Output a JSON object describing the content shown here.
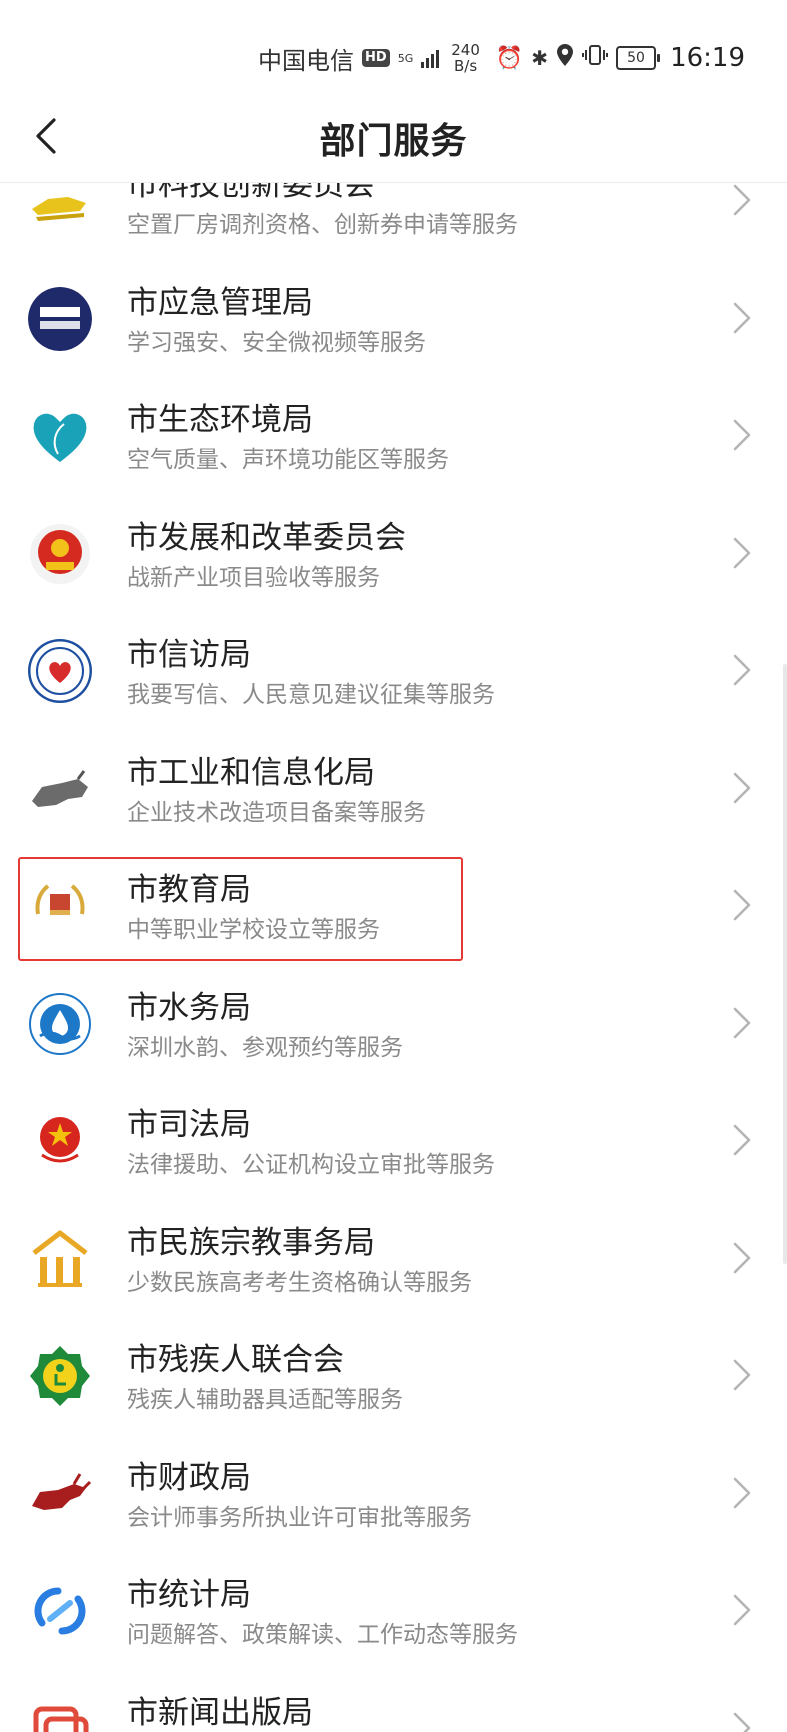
{
  "status_bar": {
    "carrier": "中国电信",
    "hd": "HD",
    "network": "5G",
    "speed_value": "240",
    "speed_unit": "B/s",
    "battery": "50",
    "time": "16:19",
    "icons": [
      "alarm-icon",
      "bluetooth-icon",
      "location-icon",
      "vibrate-icon",
      "battery-icon"
    ]
  },
  "header": {
    "title": "部门服务",
    "back_icon": "chevron-left-icon"
  },
  "highlight_color": "#e53935",
  "departments": [
    {
      "name": "市科技创新委员会",
      "desc": "空置厂房调剂资格、创新券申请等服务",
      "logo": "gold-lion-logo"
    },
    {
      "name": "市应急管理局",
      "desc": "学习强安、安全微视频等服务",
      "logo": "emergency-logo"
    },
    {
      "name": "市生态环境局",
      "desc": "空气质量、声环境功能区等服务",
      "logo": "heart-leaf-logo"
    },
    {
      "name": "市发展和改革委员会",
      "desc": "战新产业项目验收等服务",
      "logo": "national-emblem-logo"
    },
    {
      "name": "市信访局",
      "desc": "我要写信、人民意见建议征集等服务",
      "logo": "petition-logo"
    },
    {
      "name": "市工业和信息化局",
      "desc": "企业技术改造项目备案等服务",
      "logo": "bull-logo"
    },
    {
      "name": "市教育局",
      "desc": "中等职业学校设立等服务",
      "logo": "education-logo"
    },
    {
      "name": "市水务局",
      "desc": "深圳水韵、参观预约等服务",
      "logo": "water-logo"
    },
    {
      "name": "市司法局",
      "desc": "法律援助、公证机构设立审批等服务",
      "logo": "justice-logo"
    },
    {
      "name": "市民族宗教事务局",
      "desc": "少数民族高考考生资格确认等服务",
      "logo": "building-logo"
    },
    {
      "name": "市残疾人联合会",
      "desc": "残疾人辅助器具适配等服务",
      "logo": "disabled-federation-logo"
    },
    {
      "name": "市财政局",
      "desc": "会计师事务所执业许可审批等服务",
      "logo": "red-bull-logo"
    },
    {
      "name": "市统计局",
      "desc": "问题解答、政策解读、工作动态等服务",
      "logo": "statistics-logo"
    },
    {
      "name": "市新闻出版局",
      "desc": "",
      "logo": "press-logo"
    }
  ]
}
